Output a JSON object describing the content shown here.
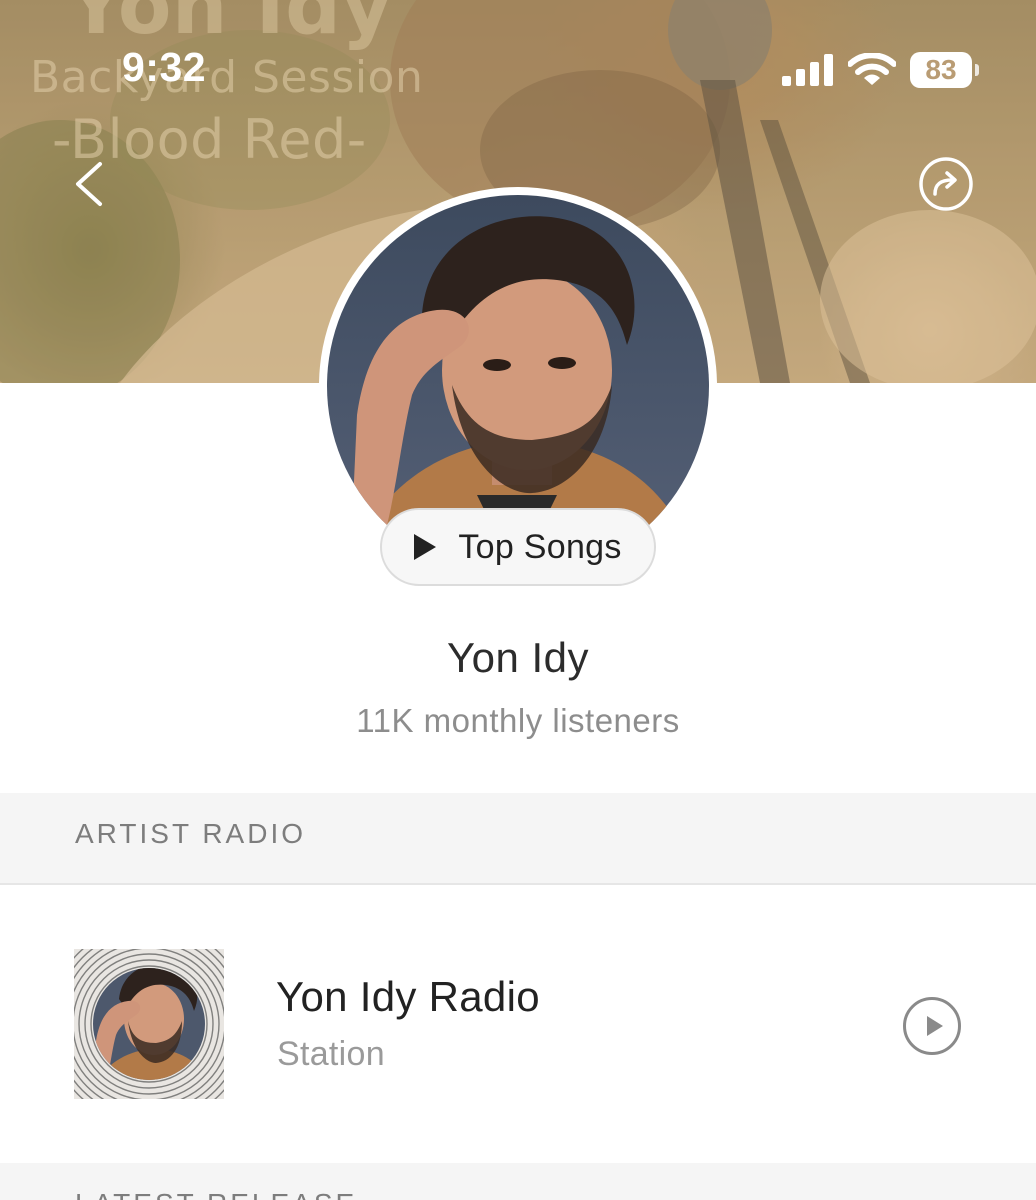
{
  "status_bar": {
    "time": "9:32",
    "battery": "83",
    "signal_icon": "cellular-signal-icon",
    "wifi_icon": "wifi-icon"
  },
  "banner": {
    "title_fragment": "Yon Idy",
    "subtitle_line1": "Backyard Session",
    "subtitle_line2": "-Blood Red-"
  },
  "nav": {
    "back_icon": "chevron-left-icon",
    "share_icon": "share-arrow-icon"
  },
  "artist": {
    "name": "Yon Idy",
    "listeners": "11K monthly listeners",
    "top_songs_label": "Top Songs"
  },
  "sections": {
    "artist_radio_header": "ARTIST RADIO",
    "latest_release_header": "LATEST RELEASE"
  },
  "radio": {
    "title": "Yon Idy Radio",
    "subtitle": "Station",
    "play_icon": "play-circle-icon"
  },
  "colors": {
    "banner_tint": "#b39a70",
    "text_primary": "#222222",
    "text_secondary": "#8d8d8d",
    "section_bg": "#f5f5f5"
  }
}
